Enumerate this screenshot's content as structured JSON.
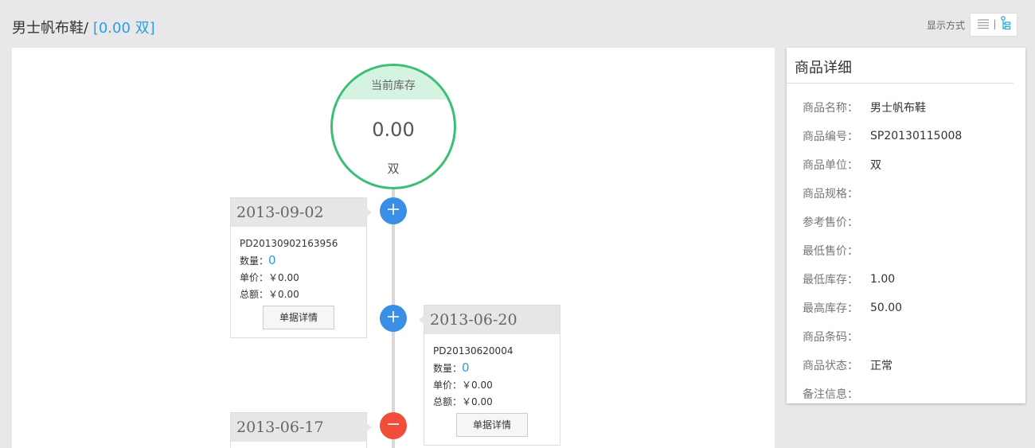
{
  "header": {
    "product_name": "男士帆布鞋/",
    "qty_text": "[0.00 双]",
    "view_mode_label": "显示方式"
  },
  "stock": {
    "label": "当前库存",
    "value": "0.00",
    "unit": "双"
  },
  "entries": [
    {
      "date": "2013-09-02",
      "type": "plus",
      "doc_no": "PD20130902163956",
      "qty_label": "数量：",
      "qty": "0",
      "price_label": "单价：",
      "price": "￥0.00",
      "total_label": "总额：",
      "total": "￥0.00",
      "button": "单据详情"
    },
    {
      "date": "2013-06-20",
      "type": "plus",
      "doc_no": "PD20130620004",
      "qty_label": "数量：",
      "qty": "0",
      "price_label": "单价：",
      "price": "￥0.00",
      "total_label": "总额：",
      "total": "￥0.00",
      "button": "单据详情"
    },
    {
      "date": "2013-06-17",
      "type": "minus"
    }
  ],
  "detail": {
    "title": "商品详细",
    "rows": [
      {
        "label": "商品名称：",
        "value": "男士帆布鞋"
      },
      {
        "label": "商品编号：",
        "value": "SP20130115008"
      },
      {
        "label": "商品单位：",
        "value": "双"
      },
      {
        "label": "商品规格：",
        "value": ""
      },
      {
        "label": "参考售价：",
        "value": ""
      },
      {
        "label": "最低售价：",
        "value": ""
      },
      {
        "label": "最低库存：",
        "value": "1.00"
      },
      {
        "label": "最高库存：",
        "value": "50.00"
      },
      {
        "label": "商品条码：",
        "value": ""
      },
      {
        "label": "商品状态：",
        "value": "正常"
      },
      {
        "label": "备注信息：",
        "value": ""
      }
    ]
  },
  "colors": {
    "accent_blue": "#2a9fe0",
    "stock_green": "#3cbf74",
    "in_node": "#3a8ee6",
    "out_node": "#f04d3a"
  }
}
